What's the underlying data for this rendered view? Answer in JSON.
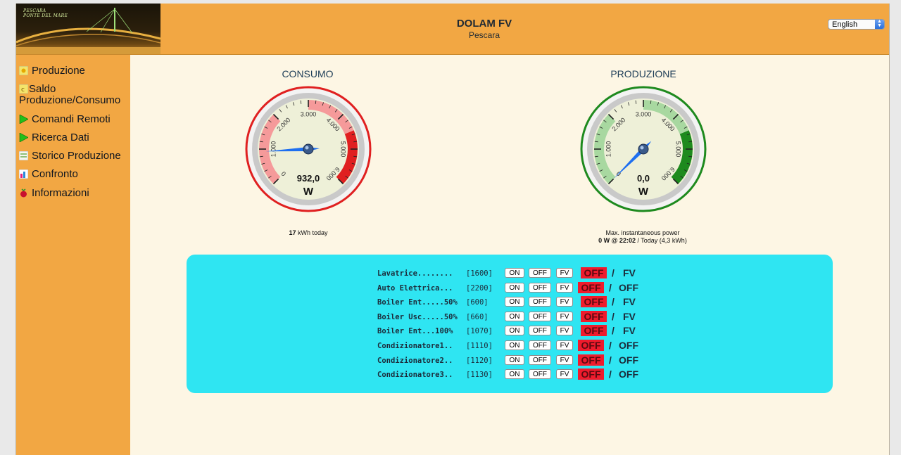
{
  "header": {
    "logo_text_line1": "PESCARA",
    "logo_text_line2": "PONTE DEL MARE",
    "title": "DOLAM FV",
    "subtitle": "Pescara",
    "language": "English"
  },
  "sidebar": {
    "items": [
      {
        "label": "Produzione",
        "icon": "sun-icon"
      },
      {
        "label": "Saldo Produzione/Consumo",
        "icon": "balance-icon"
      },
      {
        "label": "Comandi Remoti",
        "icon": "play-icon"
      },
      {
        "label": "Ricerca Dati",
        "icon": "play-icon"
      },
      {
        "label": "Storico Produzione",
        "icon": "history-icon"
      },
      {
        "label": "Confronto",
        "icon": "chart-icon"
      },
      {
        "label": "Informazioni",
        "icon": "raspberry-icon"
      }
    ]
  },
  "gauges": {
    "consumo": {
      "title": "CONSUMO",
      "value": 932.0,
      "value_text": "932,0",
      "unit": "W",
      "min": 0,
      "max": 6000,
      "ticks": [
        "0",
        "1.000",
        "2.000",
        "3.000",
        "4.000",
        "5.000",
        "6.000"
      ],
      "color": "#e02020",
      "caption_value": "17",
      "caption_text": " kWh today"
    },
    "produzione": {
      "title": "PRODUZIONE",
      "value": 0.0,
      "value_text": "0,0",
      "unit": "W",
      "min": 0,
      "max": 6000,
      "ticks": [
        "0",
        "1.000",
        "2.000",
        "3.000",
        "4.000",
        "5.000",
        "6.000"
      ],
      "color": "#1e8a1e",
      "caption_line1": "Max. instantaneous power",
      "caption_bold": "0 W @ 22:02",
      "caption_rest": "  / Today (4,3 kWh)"
    }
  },
  "devices": [
    {
      "name": "Lavatrice........",
      "power": "[1600]",
      "state": "OFF",
      "mode": "FV"
    },
    {
      "name": "Auto Elettrica...",
      "power": "[2200]",
      "state": "OFF",
      "mode": "OFF"
    },
    {
      "name": "Boiler Ent.....50%",
      "power": "[600]",
      "state": "OFF",
      "mode": "FV"
    },
    {
      "name": "Boiler Usc.....50%",
      "power": "[660]",
      "state": "OFF",
      "mode": "FV"
    },
    {
      "name": "Boiler Ent...100%",
      "power": "[1070]",
      "state": "OFF",
      "mode": "FV"
    },
    {
      "name": "Condizionatore1..",
      "power": "[1110]",
      "state": "OFF",
      "mode": "OFF"
    },
    {
      "name": "Condizionatore2..",
      "power": "[1120]",
      "state": "OFF",
      "mode": "OFF"
    },
    {
      "name": "Condizionatore3..",
      "power": "[1130]",
      "state": "OFF",
      "mode": "OFF"
    }
  ],
  "buttons": {
    "on": "ON",
    "off": "OFF",
    "fv": "FV"
  },
  "separator": "/"
}
